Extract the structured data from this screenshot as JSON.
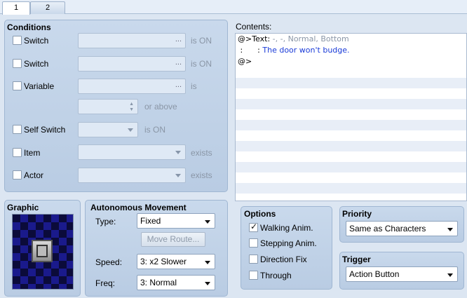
{
  "tabs": [
    {
      "label": "1"
    },
    {
      "label": "2"
    }
  ],
  "conditions": {
    "title": "Conditions",
    "switch1": {
      "label": "Switch",
      "suffix": "is ON",
      "dots": "..."
    },
    "switch2": {
      "label": "Switch",
      "suffix": "is ON",
      "dots": "..."
    },
    "variable": {
      "label": "Variable",
      "suffix": "is",
      "dots": "..."
    },
    "or_above": "or above",
    "self_switch": {
      "label": "Self Switch",
      "suffix": "is ON"
    },
    "item": {
      "label": "Item",
      "suffix": "exists"
    },
    "actor": {
      "label": "Actor",
      "suffix": "exists"
    }
  },
  "contents": {
    "label": "Contents:",
    "lines": [
      {
        "prefix": "@>Text: ",
        "rest": "-, -, Normal, Bottom"
      },
      {
        "prefix": " :      : ",
        "rest": "The door won't budge."
      },
      {
        "prefix": "@>",
        "rest": ""
      }
    ]
  },
  "graphic": {
    "title": "Graphic"
  },
  "movement": {
    "title": "Autonomous Movement",
    "type_label": "Type:",
    "type_value": "Fixed",
    "move_route": "Move Route...",
    "speed_label": "Speed:",
    "speed_value": "3: x2 Slower",
    "freq_label": "Freq:",
    "freq_value": "3: Normal"
  },
  "options": {
    "title": "Options",
    "walking": "Walking Anim.",
    "stepping": "Stepping Anim.",
    "direction_fix": "Direction Fix",
    "through": "Through",
    "walking_checked": true
  },
  "priority": {
    "title": "Priority",
    "value": "Same as Characters"
  },
  "trigger": {
    "title": "Trigger",
    "value": "Action Button"
  },
  "colors": {
    "text_blue": "#1a3bd8",
    "text_gray": "#8a96a6",
    "graphic_bg": "#1a1a8c"
  }
}
